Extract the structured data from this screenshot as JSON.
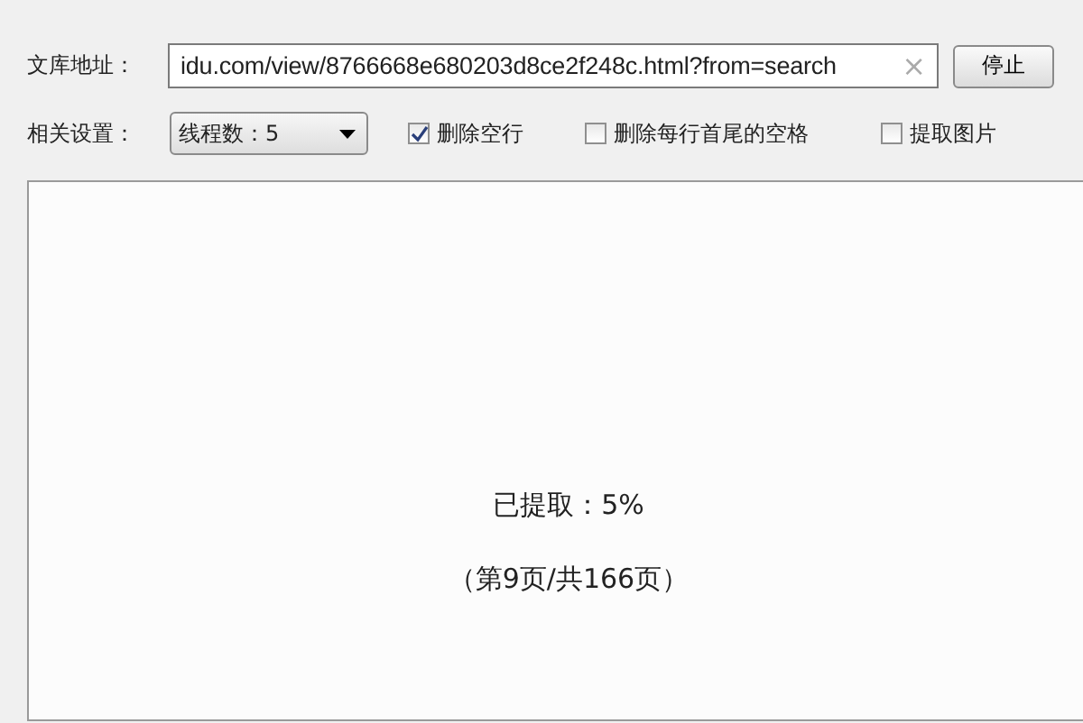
{
  "url_row": {
    "label": "文库地址：",
    "value": "idu.com/view/8766668e680203d8ce2f248c.html?from=search",
    "clear": "×",
    "button": "停止"
  },
  "settings_row": {
    "label": "相关设置：",
    "dropdown": "线程数：5",
    "options": [
      {
        "label": "删除空行",
        "checked": true
      },
      {
        "label": "删除每行首尾的空格",
        "checked": false
      },
      {
        "label": "提取图片",
        "checked": false
      }
    ]
  },
  "progress": {
    "status": "已提取：5%",
    "pages": "（第9页/共166页）"
  }
}
